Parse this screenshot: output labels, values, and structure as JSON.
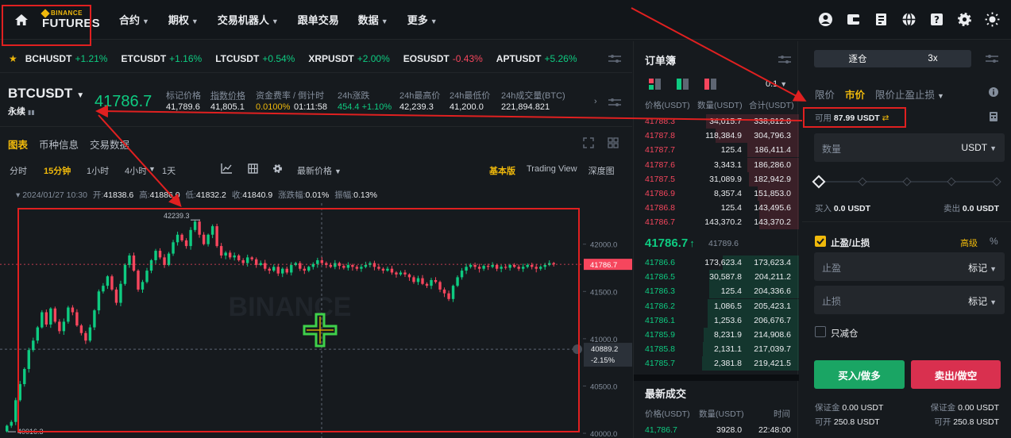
{
  "nav": {
    "logo_top": "BINANCE",
    "logo_bottom": "FUTURES",
    "items": [
      {
        "label": "合约",
        "dropdown": true
      },
      {
        "label": "期权",
        "dropdown": true
      },
      {
        "label": "交易机器人",
        "dropdown": true
      },
      {
        "label": "跟单交易",
        "dropdown": false
      },
      {
        "label": "数据",
        "dropdown": true
      },
      {
        "label": "更多",
        "dropdown": true
      }
    ]
  },
  "tickers": [
    {
      "sym": "BCHUSDT",
      "chg": "+1.21%",
      "dir": "up"
    },
    {
      "sym": "ETCUSDT",
      "chg": "+1.16%",
      "dir": "up"
    },
    {
      "sym": "LTCUSDT",
      "chg": "+0.54%",
      "dir": "up"
    },
    {
      "sym": "XRPUSDT",
      "chg": "+2.00%",
      "dir": "up"
    },
    {
      "sym": "EOSUSDT",
      "chg": "-0.43%",
      "dir": "down"
    },
    {
      "sym": "APTUSDT",
      "chg": "+5.26%",
      "dir": "up"
    }
  ],
  "symbol": {
    "name": "BTCUSDT",
    "type": "永续",
    "price": "41786.7",
    "mark_label": "标记价格",
    "mark_value": "41,789.6",
    "index_label": "指数价格",
    "index_value": "41,805.1",
    "funding_label": "资金费率 / 倒计时",
    "funding_value": "0.0100%",
    "countdown": "01:11:58",
    "chg_label": "24h涨跌",
    "chg_value": "454.4 +1.10%",
    "high_label": "24h最高价",
    "high_value": "42,239.3",
    "low_label": "24h最低价",
    "low_value": "41,200.0",
    "vol_label": "24h成交量(BTC)",
    "vol_value": "221,894.821"
  },
  "chart_tabs": [
    "图表",
    "币种信息",
    "交易数据"
  ],
  "intervals": [
    "分时",
    "15分钟",
    "1小时",
    "4小时",
    "1天"
  ],
  "interval_active": "15分钟",
  "price_type": "最新价格",
  "views": [
    "基本版",
    "Trading View",
    "深度图"
  ],
  "ohlc": {
    "date": "2024/01/27 10:30",
    "open_label": "开:",
    "open": "41838.6",
    "high_label": "高:",
    "high": "41886.0",
    "low_label": "低:",
    "low": "41832.2",
    "close_label": "收:",
    "close": "41840.9",
    "chg_label": "涨跌幅:",
    "chg": "0.01%",
    "amp_label": "振幅:",
    "amp": "0.13%"
  },
  "chart_data": {
    "type": "candlestick",
    "y_ticks": [
      "42000.0",
      "41500.0",
      "41000.0",
      "40500.0",
      "40000.0"
    ],
    "ylim": [
      39950,
      42350
    ],
    "max_label": "42239.3",
    "min_label": "40016.3",
    "last_price": "41786.7",
    "crosshair_price": "40889.2",
    "crosshair_pct": "-2.15%",
    "closes": [
      40080,
      40120,
      40350,
      40520,
      40680,
      40880,
      40980,
      41120,
      41280,
      41150,
      41320,
      41180,
      41080,
      41180,
      41330,
      41280,
      41140,
      41060,
      40980,
      41120,
      41300,
      41500,
      41560,
      41660,
      41520,
      41380,
      41580,
      41780,
      41880,
      41720,
      41520,
      41600,
      41720,
      41830,
      41930,
      41860,
      41780,
      41900,
      42020,
      42100,
      42040,
      41980,
      42150,
      42239,
      42100,
      42000,
      42100,
      42190,
      41980,
      41880,
      41910,
      41860,
      41880,
      41830,
      41800,
      41860,
      41840,
      41780,
      41800,
      41740,
      41720,
      41760,
      41690,
      41740,
      41700,
      41780,
      41800,
      41740,
      41720,
      41760,
      41790,
      41830,
      41800,
      41780,
      41760,
      41800,
      41770,
      41750,
      41780,
      41760,
      41740,
      41760,
      41780,
      41800,
      41760,
      41740,
      41720,
      41740,
      41700,
      41680,
      41700,
      41680,
      41650,
      41600,
      41640,
      41580,
      41560,
      41620,
      41600,
      41520,
      41480,
      41420,
      41560,
      41650,
      41720,
      41760,
      41780,
      41760,
      41740,
      41770,
      41760,
      41780,
      41740,
      41760,
      41750,
      41780,
      41760,
      41740,
      41760,
      41780,
      41760,
      41740,
      41760,
      41780,
      41800,
      41787
    ]
  },
  "orderbook": {
    "title": "订单簿",
    "step": "0.1",
    "col_price": "价格(USDT)",
    "col_qty": "数量(USDT)",
    "col_total": "合计(USDT)",
    "asks": [
      {
        "p": "41788.3",
        "q": "34,015.7",
        "t": "338,812.0",
        "d": 0.96
      },
      {
        "p": "41787.8",
        "q": "118,384.9",
        "t": "304,796.3",
        "d": 0.86
      },
      {
        "p": "41787.7",
        "q": "125.4",
        "t": "186,411.4",
        "d": 0.53
      },
      {
        "p": "41787.6",
        "q": "3,343.1",
        "t": "186,286.0",
        "d": 0.53
      },
      {
        "p": "41787.5",
        "q": "31,089.9",
        "t": "182,942.9",
        "d": 0.52
      },
      {
        "p": "41786.9",
        "q": "8,357.4",
        "t": "151,853.0",
        "d": 0.43
      },
      {
        "p": "41786.8",
        "q": "125.4",
        "t": "143,495.6",
        "d": 0.41
      },
      {
        "p": "41786.7",
        "q": "143,370.2",
        "t": "143,370.2",
        "d": 0.41
      }
    ],
    "mid_price": "41786.7",
    "mid_mark": "41789.6",
    "bids": [
      {
        "p": "41786.6",
        "q": "173,623.4",
        "t": "173,623.4",
        "d": 0.79
      },
      {
        "p": "41786.5",
        "q": "30,587.8",
        "t": "204,211.2",
        "d": 0.93
      },
      {
        "p": "41786.3",
        "q": "125.4",
        "t": "204,336.6",
        "d": 0.93
      },
      {
        "p": "41786.2",
        "q": "1,086.5",
        "t": "205,423.1",
        "d": 0.94
      },
      {
        "p": "41786.1",
        "q": "1,253.6",
        "t": "206,676.7",
        "d": 0.94
      },
      {
        "p": "41785.9",
        "q": "8,231.9",
        "t": "214,908.6",
        "d": 0.98
      },
      {
        "p": "41785.8",
        "q": "2,131.1",
        "t": "217,039.7",
        "d": 0.99
      },
      {
        "p": "41785.7",
        "q": "2,381.8",
        "t": "219,421.5",
        "d": 1.0
      }
    ],
    "trades_title": "最新成交",
    "tr_price": "价格(USDT)",
    "tr_qty": "数量(USDT)",
    "tr_time": "时间",
    "trades": [
      {
        "p": "41,786.7",
        "q": "3928.0",
        "t": "22:48:00"
      }
    ]
  },
  "order": {
    "margin_mode": "逐仓",
    "leverage": "3x",
    "types": [
      "限价",
      "市价",
      "限价止盈止损"
    ],
    "active_type": "市价",
    "avail_label": "可用",
    "avail_value": "87.99 USDT",
    "qty_label": "数量",
    "qty_unit": "USDT",
    "buy_label": "买入",
    "buy_value": "0.0 USDT",
    "sell_label": "卖出",
    "sell_value": "0.0 USDT",
    "tpsl_label": "止盈/止损",
    "advanced": "高级",
    "tp_label": "止盈",
    "sl_label": "止损",
    "mark_label": "标记",
    "reduce_only": "只减仓",
    "buy_btn": "买入/做多",
    "sell_btn": "卖出/做空",
    "margin_label": "保证金",
    "margin_buy": "0.00 USDT",
    "margin_sell": "0.00 USDT",
    "open_label": "可开",
    "open_buy": "250.8 USDT",
    "open_sell": "250.8 USDT"
  },
  "colors": {
    "up": "#0ecb81",
    "down": "#f6465d",
    "accent": "#f0b90b",
    "annotation": "#e02020"
  }
}
